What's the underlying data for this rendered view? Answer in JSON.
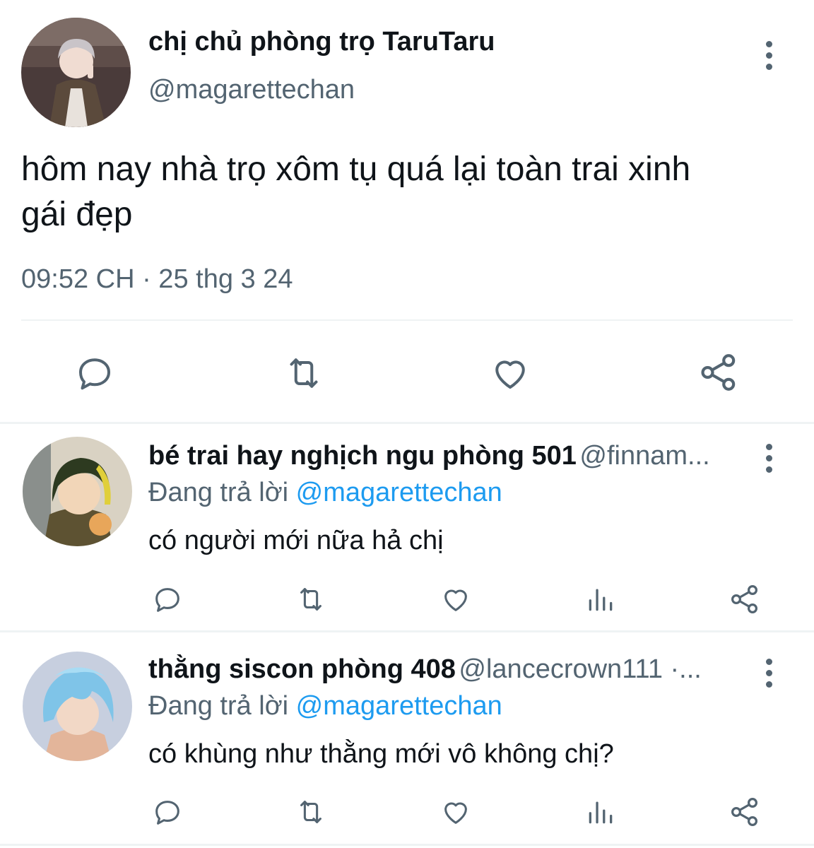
{
  "main_tweet": {
    "display_name": "chị chủ phòng trọ TaruTaru",
    "handle": "@magarettechan",
    "text_line1": "hôm nay nhà trọ xôm tụ quá lại toàn trai xinh",
    "text_line2": "gái đẹp",
    "timestamp": "09:52 CH · 25 thg 3 24",
    "actions": [
      "reply-icon",
      "retweet-icon",
      "like-icon",
      "share-icon"
    ]
  },
  "replies": [
    {
      "display_name": "bé trai hay nghịch ngu phòng 501",
      "handle": "@finnam...",
      "replying_prefix": "Đang trả lời",
      "replying_to": "@magarettechan",
      "text": "có người mới nữa hả chị",
      "actions": [
        "reply-icon",
        "retweet-icon",
        "like-icon",
        "views-icon",
        "share-icon"
      ]
    },
    {
      "display_name": "thằng siscon phòng 408",
      "handle": "@lancecrown111 ·...",
      "replying_prefix": "Đang trả lời",
      "replying_to": "@magarettechan",
      "text": "có khùng như thằng mới vô không chị?",
      "actions": [
        "reply-icon",
        "retweet-icon",
        "like-icon",
        "views-icon",
        "share-icon"
      ]
    }
  ],
  "colors": {
    "text_primary": "#0f1419",
    "text_secondary": "#536471",
    "link": "#1d9bf0",
    "divider": "#eff3f4"
  }
}
